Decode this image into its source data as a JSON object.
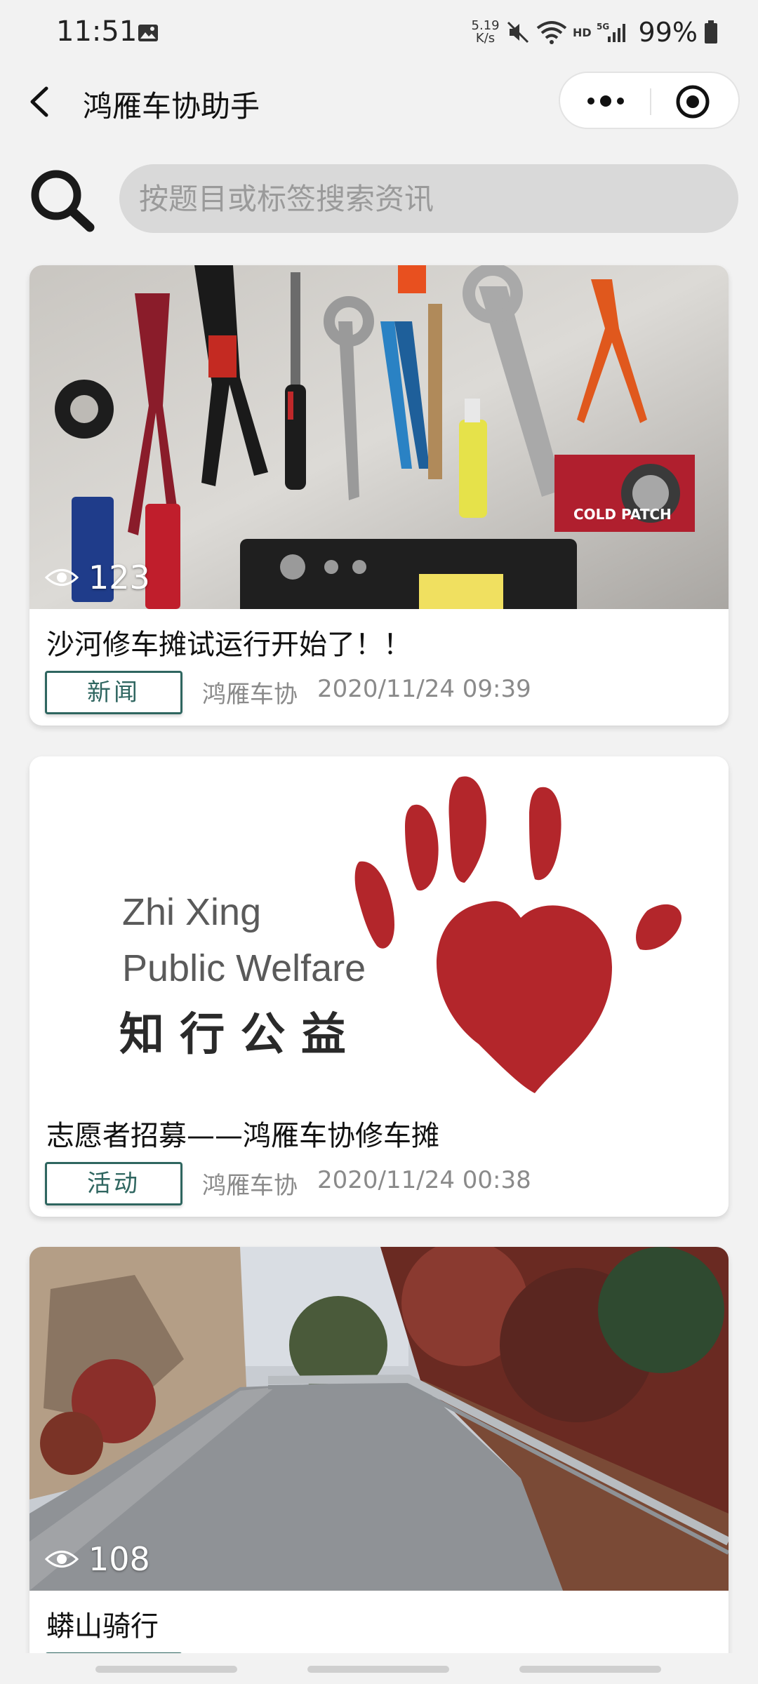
{
  "status": {
    "time": "11:51",
    "net_speed_value": "5.19",
    "net_speed_unit": "K/s",
    "battery": "99%"
  },
  "nav": {
    "title": "鸿雁车协助手"
  },
  "search": {
    "placeholder": "按题目或标签搜索资讯"
  },
  "articles": [
    {
      "views": "123",
      "title": "沙河修车摊试运行开始了！！",
      "tag": "新闻",
      "author": "鸿雁车协",
      "date": "2020/11/24 09:39",
      "image": "tools-on-wall-photo",
      "image_text": "COLD PATCH"
    },
    {
      "views": "",
      "title": "志愿者招募——鸿雁车协修车摊",
      "tag": "活动",
      "author": "鸿雁车协",
      "date": "2020/11/24 00:38",
      "image": "zhixing-public-welfare-logo",
      "logo_line1": "Zhi Xing",
      "logo_line2": "Public Welfare",
      "logo_line3": "知 行 公 益"
    },
    {
      "views": "108",
      "title": "蟒山骑行",
      "tag": "",
      "author": "",
      "date": "",
      "image": "mountain-road-photo"
    }
  ],
  "colors": {
    "tag_accent": "#2f6660",
    "background": "#f2f2f2",
    "search_bg": "#d9d9d9",
    "logo_red": "#b3262b"
  }
}
